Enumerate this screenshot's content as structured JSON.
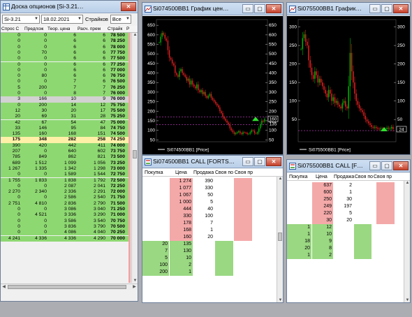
{
  "board": {
    "title": "Доска опционов [Si-3.21…",
    "series_select": "Si-3.21",
    "date_select": "18.02.2021",
    "strikes_label": "Страйков",
    "strikes_select": "Все",
    "columns": [
      "Спрос С",
      "Предлож",
      "Теор. цена",
      "Расч. прем",
      "Страйк",
      "Р"
    ],
    "rows": [
      {
        "c": [
          "0",
          "0",
          "6",
          "6",
          "78 500"
        ],
        "t": "green"
      },
      {
        "c": [
          "0",
          "0",
          "6",
          "6",
          "78 250"
        ],
        "t": "green"
      },
      {
        "c": [
          "0",
          "0",
          "6",
          "6",
          "78 000"
        ],
        "t": "green"
      },
      {
        "c": [
          "0",
          "70",
          "6",
          "6",
          "77 750"
        ],
        "t": "green"
      },
      {
        "c": [
          "0",
          "0",
          "6",
          "6",
          "77 500"
        ],
        "t": "green"
      },
      {
        "c": [
          "0",
          "0",
          "6",
          "6",
          "77 250"
        ],
        "t": "green"
      },
      {
        "c": [
          "0",
          "0",
          "6",
          "6",
          "77 000"
        ],
        "t": "green"
      },
      {
        "c": [
          "0",
          "80",
          "6",
          "6",
          "76 750"
        ],
        "t": "green"
      },
      {
        "c": [
          "0",
          "0",
          "7",
          "6",
          "76 500"
        ],
        "t": "green"
      },
      {
        "c": [
          "5",
          "200",
          "7",
          "7",
          "76 250"
        ],
        "t": "green"
      },
      {
        "c": [
          "0",
          "0",
          "8",
          "7",
          "76 000"
        ],
        "t": "green"
      },
      {
        "c": [
          "3",
          "166",
          "10",
          "9",
          "76 000"
        ],
        "t": "gray"
      },
      {
        "c": [
          "0",
          "200",
          "14",
          "12",
          "75 750"
        ],
        "t": "green"
      },
      {
        "c": [
          "12",
          "30",
          "20",
          "17",
          "75 500"
        ],
        "t": "green"
      },
      {
        "c": [
          "20",
          "69",
          "31",
          "28",
          "75 250"
        ],
        "t": "green"
      },
      {
        "c": [
          "42",
          "67",
          "54",
          "47",
          "75 000"
        ],
        "t": "green"
      },
      {
        "c": [
          "33",
          "146",
          "95",
          "84",
          "74 750"
        ],
        "t": "green"
      },
      {
        "c": [
          "135",
          "160",
          "168",
          "151",
          "74 500"
        ],
        "t": "green"
      },
      {
        "c": [
          "175",
          "348",
          "282",
          "258",
          "74 250"
        ],
        "t": "yellow"
      },
      {
        "c": [
          "390",
          "420",
          "442",
          "411",
          "74 000"
        ],
        "t": "green"
      },
      {
        "c": [
          "207",
          "0",
          "640",
          "602",
          "73 750"
        ],
        "t": "green"
      },
      {
        "c": [
          "785",
          "849",
          "862",
          "821",
          "73 500"
        ],
        "t": "green"
      },
      {
        "c": [
          "689",
          "1 512",
          "1 099",
          "1 056",
          "73 250"
        ],
        "t": "green"
      },
      {
        "c": [
          "1 267",
          "1 335",
          "1 342",
          "1 298",
          "73 000"
        ],
        "t": "green"
      },
      {
        "c": [
          "0",
          "0",
          "1 589",
          "1 544",
          "72 750"
        ],
        "t": "green"
      },
      {
        "c": [
          "1 755",
          "1 833",
          "1 838",
          "1 792",
          "72 500"
        ],
        "t": "green"
      },
      {
        "c": [
          "0",
          "0",
          "2 087",
          "2 041",
          "72 250"
        ],
        "t": "green"
      },
      {
        "c": [
          "2 270",
          "2 340",
          "2 336",
          "2 291",
          "72 000"
        ],
        "t": "green"
      },
      {
        "c": [
          "0",
          "0",
          "2 586",
          "2 540",
          "71 750"
        ],
        "t": "green"
      },
      {
        "c": [
          "2 751",
          "4 810",
          "2 836",
          "2 790",
          "71 500"
        ],
        "t": "green"
      },
      {
        "c": [
          "0",
          "0",
          "3 086",
          "3 040",
          "71 250"
        ],
        "t": "green"
      },
      {
        "c": [
          "0",
          "4 521",
          "3 336",
          "3 290",
          "71 000"
        ],
        "t": "green"
      },
      {
        "c": [
          "0",
          "0",
          "3 586",
          "3 540",
          "70 750"
        ],
        "t": "green"
      },
      {
        "c": [
          "0",
          "0",
          "3 836",
          "3 790",
          "70 500"
        ],
        "t": "green"
      },
      {
        "c": [
          "0",
          "0",
          "4 086",
          "4 040",
          "70 250"
        ],
        "t": "green"
      },
      {
        "c": [
          "4 241",
          "4 336",
          "4 336",
          "4 290",
          "70 000"
        ],
        "t": "green"
      }
    ]
  },
  "chart1": {
    "title": "Si074500BB1 График цен…",
    "legend": "Si074500BB1 [Price]",
    "y_ticks": [
      "650",
      "600",
      "550",
      "500",
      "450",
      "400",
      "350",
      "300",
      "250",
      "200",
      "150",
      "100",
      "50"
    ],
    "price_label": "160",
    "price_label2": "135",
    "chart_data": {
      "type": "candlestick",
      "ylim": [
        40,
        680
      ],
      "close": [
        560,
        590,
        610,
        600,
        580,
        570,
        520,
        480,
        470,
        450,
        440,
        400,
        390,
        380,
        410,
        420,
        400,
        390,
        380,
        360,
        370,
        340,
        360,
        340,
        330,
        320,
        340,
        310,
        300,
        310,
        290,
        300,
        280,
        270,
        280,
        290,
        270,
        260,
        250,
        240,
        230,
        220,
        200,
        190,
        170,
        160,
        150,
        140,
        130,
        110,
        100,
        90,
        80,
        85,
        90,
        95,
        85,
        80,
        90,
        88,
        86,
        80,
        82,
        90,
        100,
        98,
        85,
        83,
        90,
        110,
        130,
        150,
        145,
        160
      ]
    }
  },
  "chart2": {
    "title": "Si075500BB1 График…",
    "legend": "Si075500BB1 [Price]",
    "y_ticks": [
      "300",
      "250",
      "200",
      "150",
      "100",
      "50"
    ],
    "price_label": "24",
    "chart_data": {
      "type": "candlestick",
      "ylim": [
        -10,
        320
      ],
      "close": [
        240,
        270,
        280,
        260,
        250,
        210,
        190,
        170,
        160,
        180,
        170,
        150,
        160,
        150,
        140,
        130,
        120,
        110,
        130,
        120,
        100,
        110,
        95,
        100,
        90,
        85,
        80,
        95,
        100,
        85,
        80,
        140,
        230,
        180,
        150,
        120,
        100,
        90,
        80,
        75,
        70,
        60,
        50,
        45,
        40,
        35,
        30,
        28,
        30,
        27,
        25,
        24,
        26,
        25,
        23,
        24,
        28,
        25,
        26,
        30,
        24
      ]
    }
  },
  "dom1": {
    "title": "Si074500BB1 CALL [FORTS…",
    "columns": [
      "Покупка",
      "Цена",
      "Продажа",
      "Своя по",
      "Своя пр"
    ],
    "rows": [
      {
        "price": "1 274",
        "sell": "390",
        "ask": true
      },
      {
        "price": "1 077",
        "sell": "330",
        "ask": true
      },
      {
        "price": "1 067",
        "sell": "50",
        "ask": true
      },
      {
        "price": "1 000",
        "sell": "5",
        "ask": true
      },
      {
        "price": "444",
        "sell": "40",
        "ask": true
      },
      {
        "price": "330",
        "sell": "100",
        "ask": true
      },
      {
        "price": "178",
        "sell": "7",
        "ask": true
      },
      {
        "price": "168",
        "sell": "1",
        "ask": true
      },
      {
        "price": "160",
        "sell": "20",
        "ask": true
      },
      {
        "buy": "20",
        "price": "135",
        "bid": true
      },
      {
        "buy": "7",
        "price": "130",
        "bid": true
      },
      {
        "buy": "5",
        "price": "10",
        "bid": true
      },
      {
        "buy": "100",
        "price": "2",
        "bid": true
      },
      {
        "buy": "200",
        "price": "1",
        "bid": true
      }
    ]
  },
  "dom2": {
    "title": "Si075500BB1 CALL [F…",
    "columns": [
      "Покупка",
      "Цена",
      "Продажа",
      "Своя по",
      "Своя пр"
    ],
    "rows": [
      {
        "price": "637",
        "sell": "2",
        "ask": true
      },
      {
        "price": "600",
        "sell": "1",
        "ask": true
      },
      {
        "price": "250",
        "sell": "30",
        "ask": true
      },
      {
        "price": "249",
        "sell": "197",
        "ask": true
      },
      {
        "price": "220",
        "sell": "5",
        "ask": true
      },
      {
        "price": "30",
        "sell": "20",
        "ask": true
      },
      {
        "buy": "1",
        "price": "12",
        "bid": true
      },
      {
        "buy": "1",
        "price": "10",
        "bid": true
      },
      {
        "buy": "18",
        "price": "9",
        "bid": true
      },
      {
        "buy": "20",
        "price": "8",
        "bid": true
      },
      {
        "buy": "1",
        "price": "2",
        "bid": true
      }
    ]
  },
  "colors": {
    "ask": "#f4a9a9",
    "bid": "#9ad882",
    "board_row": "#8ed872",
    "atm_row": "#fff0a8",
    "chart_bg": "#000000",
    "candle_up": "#00b000",
    "candle_down": "#e02020"
  }
}
